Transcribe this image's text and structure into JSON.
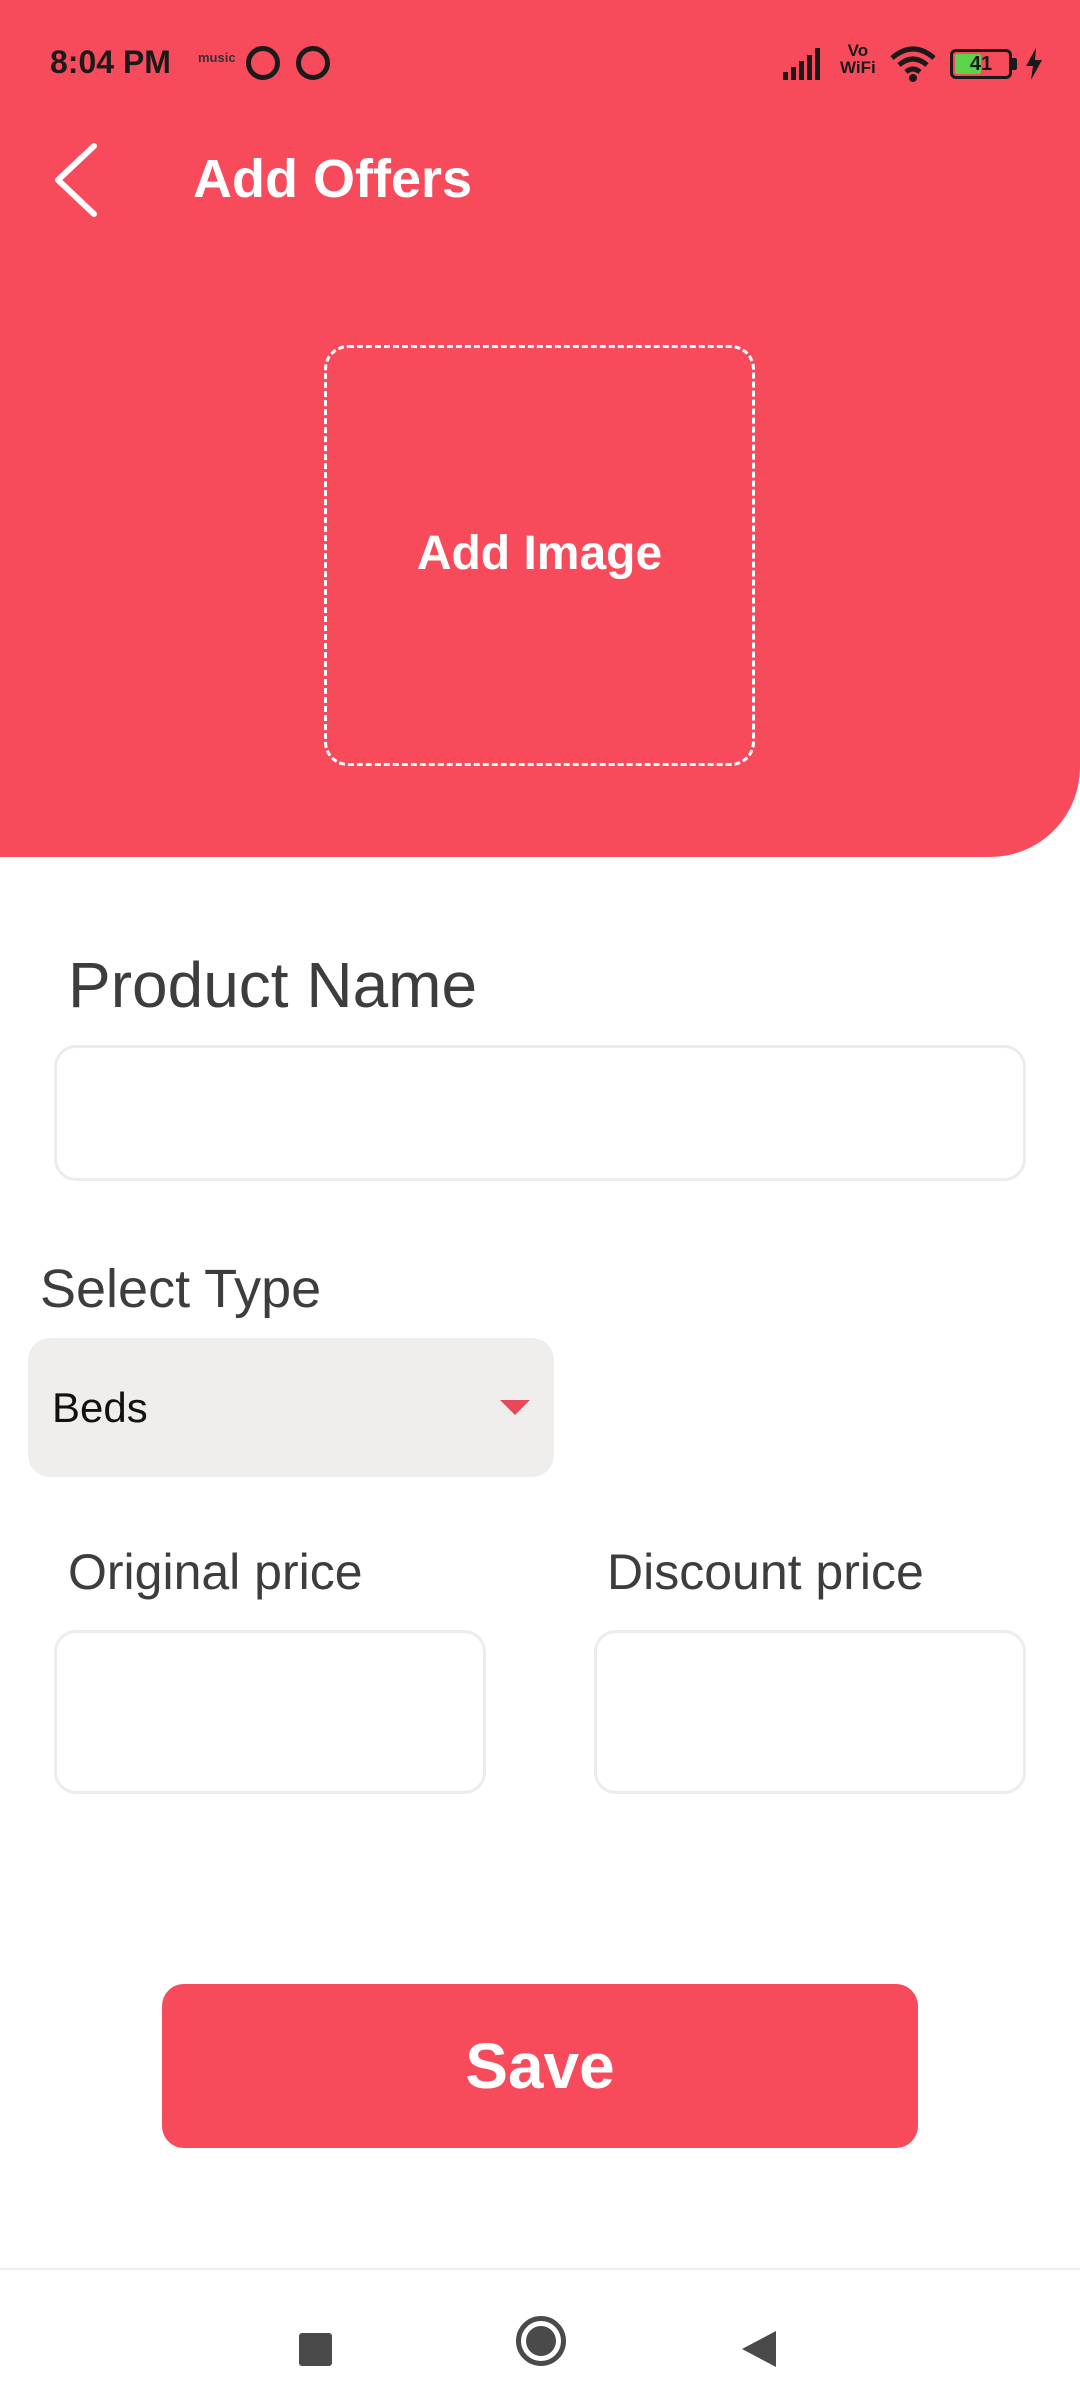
{
  "status_bar": {
    "time": "8:04 PM",
    "music_label": "music",
    "vowifi_top": "Vo",
    "vowifi_bottom": "WiFi",
    "battery_level": "41"
  },
  "toolbar": {
    "title": "Add Offers"
  },
  "image_picker": {
    "label": "Add Image"
  },
  "form": {
    "product_name_label": "Product Name",
    "product_name_value": "",
    "select_type_label": "Select Type",
    "select_type_value": "Beds",
    "original_price_label": "Original price",
    "original_price_value": "",
    "discount_price_label": "Discount price",
    "discount_price_value": ""
  },
  "save_label": "Save",
  "colors": {
    "accent": "#f74b5c",
    "select_bg": "#efeeec",
    "label_text": "#3d3d3d"
  }
}
